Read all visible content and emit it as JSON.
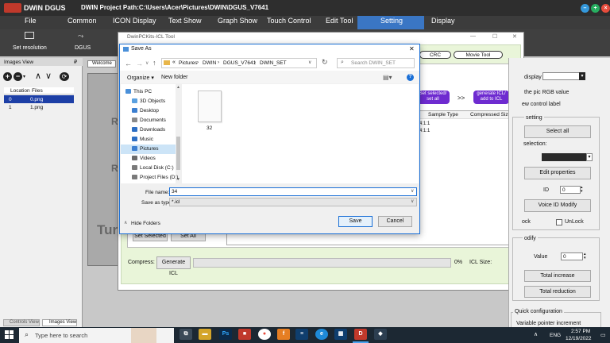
{
  "app": {
    "logo_text": "DWIN DGUS",
    "title": "DWIN Project Path:C:\\Users\\Acer\\Pictures\\DWIN\\DGUS_V7641"
  },
  "menu": [
    "File",
    "Common",
    "ICON Display",
    "Text Show",
    "Graph Show",
    "Touch Control",
    "Edit Tool",
    "Setting",
    "Display"
  ],
  "toolbar": {
    "set_resolution": "Set resolution",
    "dgus": "DGUS"
  },
  "images_view": {
    "title": "Images View",
    "pin": "₽",
    "columns": [
      "Location",
      "Files"
    ],
    "rows": [
      {
        "location": "0",
        "file": "0.png"
      },
      {
        "location": "1",
        "file": "1.png"
      }
    ]
  },
  "welcome_tab": "Welcome",
  "canvas_letters": {
    "r1": "R",
    "r2": "R",
    "tur": "Tur"
  },
  "bottom_tabs": {
    "controls_view": "Controls View",
    "images_view": "Images View"
  },
  "icl_tool": {
    "title": "DwinPCKits-ICL Tool",
    "top_buttons": {
      "crc": "CRC",
      "movie_tool": "Movie Tool"
    },
    "set_selected": "Set selected/ set all",
    "arrow": ">>",
    "generate_icl": "generate ICL/ add to ICL",
    "table_headers": [
      "Sample Type",
      "Compressed Size"
    ],
    "table_rows": [
      "4:1:1",
      "4:1:1"
    ],
    "set_selected_btn": "Set Selected",
    "set_all_btn": "Set All",
    "compress_label": "Compress:",
    "generate_btn": "Generate ICL",
    "percent": "0%",
    "icl_size": "ICL Size:"
  },
  "right_panel": {
    "display_label": "display",
    "pic_rgb": "the pic RGB value",
    "control_label": "ew control label",
    "setting_header": "setting",
    "select_all": "Select all",
    "selection": "selection:",
    "edit_properties": "Edit properties",
    "id_label": "ID",
    "id_value": "0",
    "voice_id_modify": "Voice ID Modify",
    "lock": "ock",
    "unlock": "UnLock",
    "modify_header": "odify",
    "value_label": "Value",
    "value_value": "0",
    "total_increase": "Total increase",
    "total_reduction": "Total reduction",
    "quick_config": "Quick configuration",
    "variable_pointer": "Variable pointer increment"
  },
  "save_dialog": {
    "title": "Save As",
    "close": "✕",
    "path": [
      "Pictures",
      "DWIN",
      "DGUS_V7641",
      "DWIN_SET"
    ],
    "path_prefix": "«",
    "search_placeholder": "Search DWIN_SET",
    "organize": "Organize ▾",
    "new_folder": "New folder",
    "help": "?",
    "nav_items": [
      {
        "label": "This PC",
        "color": "#4a90d9"
      },
      {
        "label": "3D Objects",
        "color": "#5aa0e0"
      },
      {
        "label": "Desktop",
        "color": "#3c7fd0"
      },
      {
        "label": "Documents",
        "color": "#8a8a8a"
      },
      {
        "label": "Downloads",
        "color": "#2d6fc4"
      },
      {
        "label": "Music",
        "color": "#2d6fc4"
      },
      {
        "label": "Pictures",
        "color": "#3c7fd0"
      },
      {
        "label": "Videos",
        "color": "#6a6a6a"
      },
      {
        "label": "Local Disk (C:)",
        "color": "#7a7a7a"
      },
      {
        "label": "Project Files (D:)",
        "color": "#7a7a7a"
      }
    ],
    "file_item": "32",
    "file_name_label": "File name:",
    "file_name_value": "34",
    "save_as_type_label": "Save as type:",
    "save_as_type_value": "*.icl",
    "hide_folders": "Hide Folders",
    "save_btn": "Save",
    "cancel_btn": "Cancel"
  },
  "taskbar": {
    "search_placeholder": "Type here to search",
    "time": "2:57 PM",
    "date": "12/19/2022",
    "lang": "ENG"
  },
  "colors": {
    "app_header": "#3c3c3c",
    "accent_purple": "#6e2bd0",
    "setting_tab": "#3a76c4",
    "dialog_border": "#1a6fd6",
    "taskbar": "#1c2833"
  }
}
